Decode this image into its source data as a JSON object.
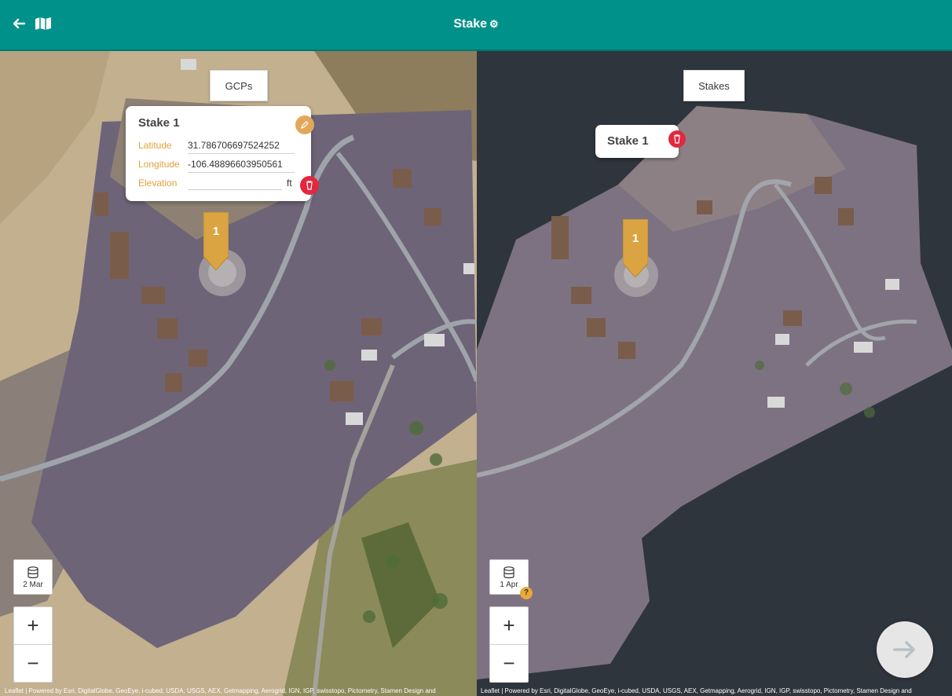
{
  "header": {
    "title": "Stake",
    "title_icon": "gear-icon",
    "back_icon": "arrow-left-icon",
    "map_icon": "map-icon",
    "color": "#00918a"
  },
  "left_pane": {
    "layer_tab": "GCPs",
    "popup": {
      "title": "Stake 1",
      "latitude_label": "Latitude",
      "latitude_value": "31.786706697524252",
      "longitude_label": "Longitude",
      "longitude_value": "-106.48896603950561",
      "elevation_label": "Elevation",
      "elevation_value": "",
      "elevation_unit": "ft"
    },
    "marker_number": "1",
    "date_button": "2 Mar",
    "zoom_in": "+",
    "zoom_out": "−",
    "attribution": "Leaflet | Powered by Esri, DigitalGlobe, GeoEye, i-cubed, USDA, USGS, AEX, Getmapping, Aerogrid, IGN, IGP, swisstopo, Pictometry, Stamen Design and"
  },
  "right_pane": {
    "layer_tab": "Stakes",
    "stake_label": "Stake 1",
    "marker_number": "1",
    "date_button": "1 Apr",
    "help_badge": "?",
    "zoom_in": "+",
    "zoom_out": "−",
    "attribution": "Leaflet | Powered by Esri, DigitalGlobe, GeoEye, i-cubed, USDA, USGS, AEX, Getmapping, Aerogrid, IGN, IGP, swisstopo, Pictometry, Stamen Design and"
  },
  "colors": {
    "accent": "#e0a23a",
    "delete": "#e2273f",
    "marker": "#d9a441"
  }
}
